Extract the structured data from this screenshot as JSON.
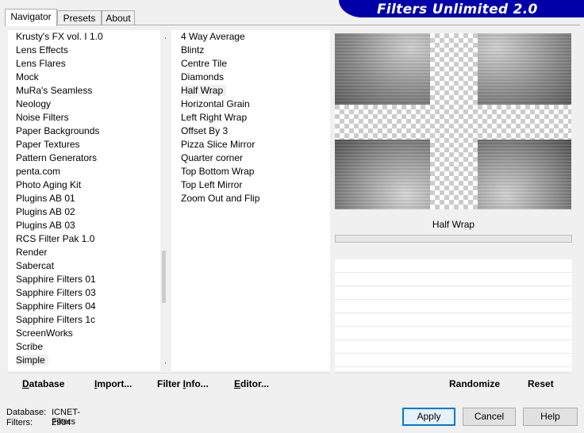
{
  "tabs": [
    {
      "label": "Navigator",
      "active": true
    },
    {
      "label": "Presets",
      "active": false
    },
    {
      "label": "About",
      "active": false
    }
  ],
  "banner": {
    "title": "Filters Unlimited 2.0"
  },
  "categories": [
    "Krusty's FX vol. I 1.0",
    "Lens Effects",
    "Lens Flares",
    "Mock",
    "MuRa's Seamless",
    "Neology",
    "Noise Filters",
    "Paper Backgrounds",
    "Paper Textures",
    "Pattern Generators",
    "penta.com",
    "Photo Aging Kit",
    "Plugins AB 01",
    "Plugins AB 02",
    "Plugins AB 03",
    "RCS Filter Pak 1.0",
    "Render",
    "Sabercat",
    "Sapphire Filters 01",
    "Sapphire Filters 03",
    "Sapphire Filters 04",
    "Sapphire Filters 1c",
    "ScreenWorks",
    "Scribe",
    "Simple"
  ],
  "selected_category": "Simple",
  "filters": [
    "4 Way Average",
    "Blintz",
    "Centre Tile",
    "Diamonds",
    "Half Wrap",
    "Horizontal Grain",
    "Left Right Wrap",
    "Offset By 3",
    "Pizza Slice Mirror",
    "Quarter corner",
    "Top Bottom Wrap",
    "Top Left Mirror",
    "Zoom Out and Flip"
  ],
  "selected_filter": "Half Wrap",
  "preview": {
    "filter_name": "Half Wrap"
  },
  "toolbar": {
    "database": {
      "accel": "D",
      "rest": "atabase"
    },
    "import": {
      "accel": "I",
      "rest": "mport..."
    },
    "filter_info": {
      "pre": "Filter ",
      "accel": "I",
      "rest": "nfo..."
    },
    "editor": {
      "accel": "E",
      "rest": "ditor..."
    },
    "randomize": "Randomize",
    "reset": "Reset"
  },
  "status": {
    "database_label": "Database:",
    "database_value": "ICNET-Filters",
    "filters_label": "Filters:",
    "filters_value": "2904"
  },
  "buttons": {
    "apply": "Apply",
    "cancel": "Cancel",
    "help": "Help"
  }
}
